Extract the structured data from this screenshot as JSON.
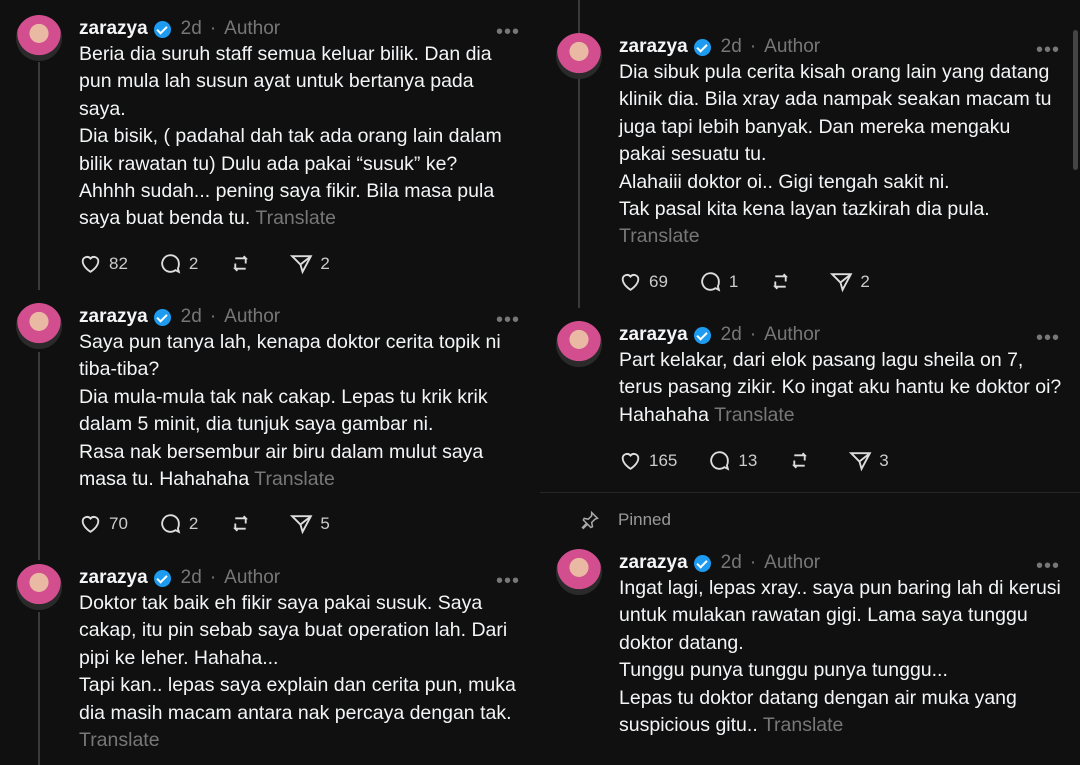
{
  "posts": [
    {
      "username": "zarazya",
      "time": "2d",
      "role": "Author",
      "lines": [
        "Beria dia suruh staff semua keluar bilik. Dan dia pun mula lah susun ayat untuk bertanya pada saya.",
        "Dia bisik, ( padahal dah tak ada orang lain dalam bilik rawatan tu) Dulu ada pakai “susuk” ke?",
        "Ahhhh sudah... pening saya fikir. Bila masa pula saya buat benda tu."
      ],
      "translate": "Translate",
      "likes": "82",
      "replies": "2",
      "reposts": "",
      "shares": "2"
    },
    {
      "username": "zarazya",
      "time": "2d",
      "role": "Author",
      "lines": [
        "Saya pun tanya lah, kenapa doktor cerita topik ni tiba-tiba?",
        "Dia mula-mula tak nak cakap. Lepas tu krik krik dalam 5 minit, dia tunjuk saya gambar ni.",
        "Rasa nak bersembur air biru dalam mulut saya masa tu. Hahahaha"
      ],
      "translate": "Translate",
      "likes": "70",
      "replies": "2",
      "reposts": "",
      "shares": "5"
    },
    {
      "username": "zarazya",
      "time": "2d",
      "role": "Author",
      "lines": [
        "Doktor tak baik eh fikir saya pakai susuk. Saya cakap, itu pin sebab saya buat operation lah. Dari pipi ke leher. Hahaha...",
        "Tapi kan.. lepas saya explain dan cerita pun, muka dia masih macam antara nak percaya dengan tak."
      ],
      "translate": "Translate"
    },
    {
      "username": "zarazya",
      "time": "2d",
      "role": "Author",
      "lines": [
        "Dia sibuk pula cerita kisah orang lain yang datang klinik dia. Bila xray ada nampak seakan macam tu juga tapi lebih banyak. Dan mereka mengaku pakai sesuatu tu.",
        "Alahaiii doktor oi.. Gigi tengah sakit ni.",
        "Tak pasal kita kena layan tazkirah dia pula."
      ],
      "translate": "Translate",
      "likes": "69",
      "replies": "1",
      "reposts": "",
      "shares": "2"
    },
    {
      "username": "zarazya",
      "time": "2d",
      "role": "Author",
      "lines": [
        "Part kelakar, dari elok pasang lagu sheila on 7, terus pasang zikir. Ko ingat aku hantu ke doktor oi? Hahahaha"
      ],
      "translate": "Translate",
      "likes": "165",
      "replies": "13",
      "reposts": "",
      "shares": "3"
    },
    {
      "username": "zarazya",
      "time": "2d",
      "role": "Author",
      "lines": [
        "Ingat lagi, lepas xray.. saya pun baring lah di kerusi untuk mulakan rawatan gigi. Lama saya tunggu doktor datang.",
        "Tunggu punya tunggu punya tunggu...",
        "Lepas tu doktor datang dengan air muka yang suspicious gitu.."
      ],
      "translate": "Translate"
    }
  ],
  "pinned_label": "Pinned",
  "icons": [
    "heart-icon",
    "reply-icon",
    "repost-icon",
    "share-icon",
    "more-icon",
    "pin-icon",
    "verified-icon"
  ]
}
